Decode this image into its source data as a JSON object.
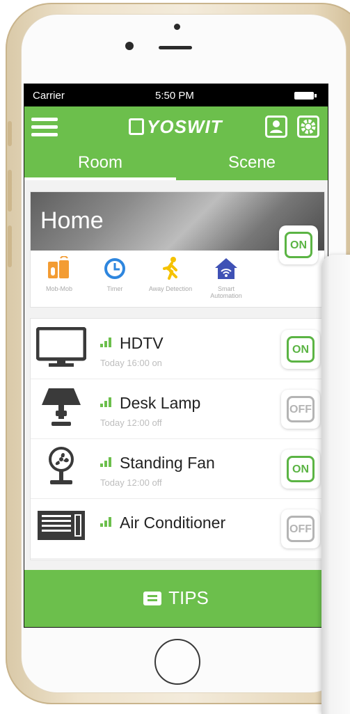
{
  "status_bar": {
    "carrier": "Carrier",
    "time": "5:50 PM"
  },
  "header": {
    "logo_text": "YOSWIT"
  },
  "tabs": [
    {
      "label": "Room",
      "active": true
    },
    {
      "label": "Scene",
      "active": false
    }
  ],
  "home": {
    "title": "Home",
    "master_toggle": "ON",
    "features": [
      {
        "label": "Mob-Mob",
        "icon": "mob-mob-icon"
      },
      {
        "label": "Timer",
        "icon": "timer-icon"
      },
      {
        "label": "Away Detection",
        "icon": "away-detection-icon"
      },
      {
        "label": "Smart Automation",
        "icon": "smart-automation-icon"
      }
    ]
  },
  "devices": [
    {
      "name": "HDTV",
      "subtitle": "Today 16:00 on",
      "state": "ON",
      "icon": "tv-icon"
    },
    {
      "name": "Desk Lamp",
      "subtitle": "Today 12:00 off",
      "state": "OFF",
      "icon": "lamp-icon"
    },
    {
      "name": "Standing Fan",
      "subtitle": "Today 12:00 off",
      "state": "ON",
      "icon": "fan-icon"
    },
    {
      "name": "Air Conditioner",
      "subtitle": "",
      "state": "OFF",
      "icon": "air-conditioner-icon"
    }
  ],
  "footer": {
    "tips_label": "TIPS"
  },
  "colors": {
    "accent": "#6cbf4c",
    "on": "#5bb444",
    "off": "#b4b4b4"
  }
}
